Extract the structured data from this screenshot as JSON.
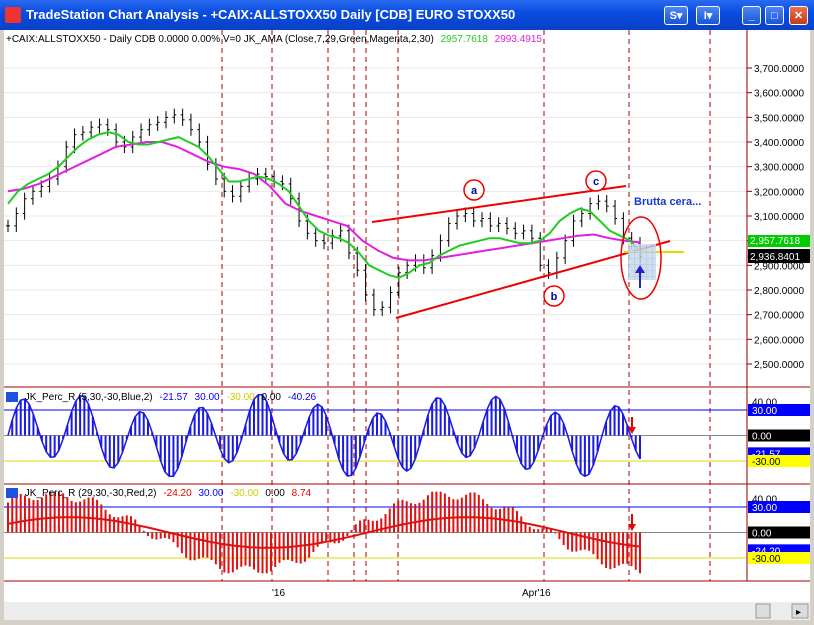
{
  "window": {
    "title": "TradeStation Chart Analysis - +CAIX:ALLSTOXX50 Daily [CDB] EURO STOXX50",
    "menu1": "S",
    "menu2": "I",
    "colors": {
      "titlebar": "#0a4de0"
    }
  },
  "price_pane": {
    "info": "+CAIX:ALLSTOXX50 - Daily  CDB  0.0000  0.00%  V=0  JK_AMA (Close,7,29,Green,Magenta,2,30)",
    "green_value": "2957.7618",
    "magenta_value": "2993.4915",
    "last_price_label": "2,936.8401",
    "green_marker_label": "2,957.7618",
    "y_ticks": [
      "3,700.0000",
      "3,600.0000",
      "3,500.0000",
      "3,400.0000",
      "3,300.0000",
      "3,200.0000",
      "3,100.0000",
      "3,000.0000",
      "2,900.0000",
      "2,800.0000",
      "2,700.0000",
      "2,600.0000",
      "2,500.0000"
    ],
    "annotations": {
      "a": "a",
      "b": "b",
      "c": "c",
      "note": "Brutta cera..."
    }
  },
  "perc_r_pane1": {
    "name": "JK_Perc_R (5,30,-30,Blue,2)",
    "v1": "-21.57",
    "v2": "30.00",
    "v3": "-30.00",
    "v4": "0.00",
    "v5": "-40.26",
    "axis_labels": [
      "40.00",
      "30.00",
      "0.00",
      "-21.57",
      "-30.00"
    ]
  },
  "perc_r_pane2": {
    "name": "JK_Perc_R (29,30,-30,Red,2)",
    "v1": "-24.20",
    "v2": "30.00",
    "v3": "-30.00",
    "v4": "0.00",
    "v5": "8.74",
    "axis_labels": [
      "40.00",
      "30.00",
      "0.00",
      "-24.20",
      "-30.00"
    ]
  },
  "x_axis": {
    "labels": [
      "'16",
      "Apr'16"
    ]
  },
  "chart_data": {
    "type": "line",
    "price_series": {
      "name": "+CAIX:ALLSTOXX50",
      "close": [
        3060,
        3110,
        3170,
        3200,
        3220,
        3250,
        3300,
        3380,
        3430,
        3440,
        3460,
        3470,
        3450,
        3400,
        3380,
        3420,
        3450,
        3470,
        3480,
        3500,
        3510,
        3490,
        3450,
        3400,
        3310,
        3250,
        3200,
        3180,
        3220,
        3250,
        3270,
        3260,
        3240,
        3230,
        3170,
        3080,
        3030,
        3000,
        2990,
        3020,
        3040,
        2950,
        2880,
        2780,
        2720,
        2730,
        2790,
        2870,
        2900,
        2920,
        2890,
        2940,
        3000,
        3070,
        3100,
        3110,
        3080,
        3090,
        3060,
        3070,
        3050,
        3030,
        3040,
        3010,
        2900,
        2870,
        2930,
        3000,
        3080,
        3110,
        3150,
        3160,
        3140,
        3090,
        3010,
        2990,
        2936
      ],
      "green_ama": [
        3150,
        3200,
        3230,
        3250,
        3270,
        3300,
        3340,
        3380,
        3410,
        3430,
        3440,
        3430,
        3400,
        3390,
        3390,
        3400,
        3410,
        3420,
        3400,
        3380,
        3340,
        3290,
        3240,
        3240,
        3250,
        3260,
        3250,
        3230,
        3200,
        3140,
        3080,
        3040,
        3020,
        3010,
        2990,
        2950,
        2900,
        2880,
        2860,
        2850,
        2870,
        2900,
        2910,
        2940,
        2960,
        2980,
        2990,
        3000,
        3010,
        3010,
        3000,
        2990,
        2990,
        3000,
        3030,
        3080,
        3110,
        3130,
        3120,
        3080,
        3040,
        3020,
        3000,
        2958
      ],
      "magenta_ama": [
        3200,
        3210,
        3230,
        3260,
        3290,
        3320,
        3350,
        3380,
        3390,
        3400,
        3400,
        3380,
        3350,
        3320,
        3300,
        3290,
        3270,
        3220,
        3150,
        3120,
        3100,
        3080,
        3060,
        3000,
        2960,
        2930,
        2920,
        2920,
        2930,
        2940,
        2950,
        2960,
        2970,
        2980,
        2990,
        3000,
        3010,
        3020,
        3025,
        3010,
        3000,
        2993
      ]
    }
  }
}
